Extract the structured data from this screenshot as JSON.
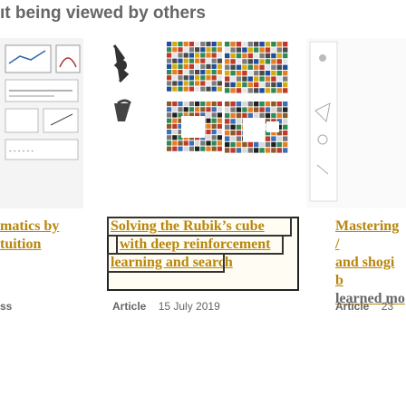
{
  "section": {
    "heading": "ıt being viewed by others"
  },
  "cards": [
    {
      "title_lines": [
        "matics by",
        "tuition"
      ],
      "type": "ss",
      "date": ""
    },
    {
      "title_lines": [
        "Solving the Rubik’s cube",
        "with deep reinforcement",
        "learning and search"
      ],
      "type": "Article",
      "date": "15 July 2019"
    },
    {
      "title_lines": [
        "Mastering /",
        "and shogi b",
        "learned mo"
      ],
      "type": "Article",
      "date": "23"
    }
  ],
  "colors": {
    "link": "#b8860b",
    "heading": "#666666",
    "meta": "#666666"
  }
}
